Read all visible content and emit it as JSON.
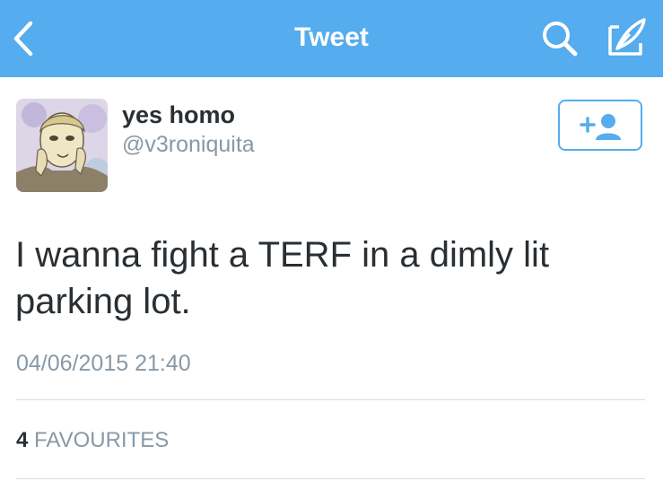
{
  "navbar": {
    "title": "Tweet",
    "background": "#55acee",
    "icons": [
      "chevron-left-icon",
      "search-icon",
      "compose-icon"
    ]
  },
  "tweet": {
    "author": {
      "display_name": "yes homo",
      "handle": "@v3roniquita"
    },
    "follow_button": {
      "icon": "add-user-icon"
    },
    "text": "I wanna fight a TERF in a dimly lit parking lot.",
    "timestamp": "04/06/2015 21:40",
    "stats": {
      "favourites_count": "4",
      "favourites_label": "FAVOURITES"
    }
  },
  "colors": {
    "accent": "#55acee",
    "text_primary": "#292f33",
    "text_secondary": "#8899a6",
    "divider": "#d8dde1"
  }
}
